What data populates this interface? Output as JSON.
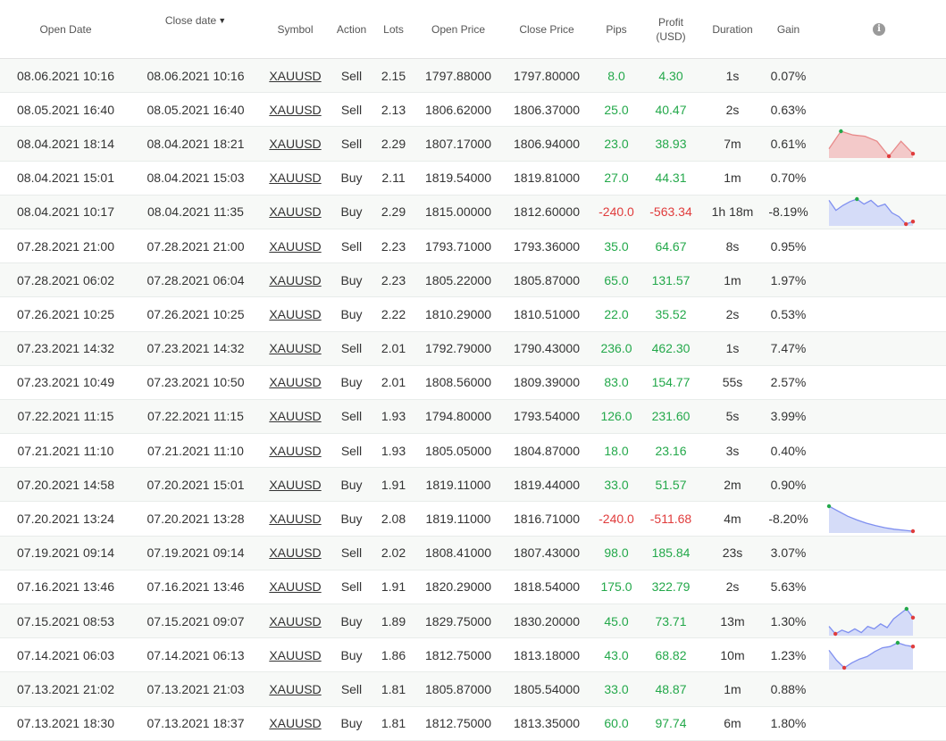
{
  "columns": {
    "open_date": "Open Date",
    "close_date": "Close date",
    "symbol": "Symbol",
    "action": "Action",
    "lots": "Lots",
    "open_price": "Open Price",
    "close_price": "Close Price",
    "pips": "Pips",
    "profit_line1": "Profit",
    "profit_line2": "(USD)",
    "duration": "Duration",
    "gain": "Gain",
    "info_icon": "info-icon",
    "sort_indicator": "▼"
  },
  "colors": {
    "positive": "#23a84a",
    "negative": "#e03c3c",
    "spark_sell_fill": "#f3c9c9",
    "spark_sell_line": "#e88a8a",
    "spark_buy_fill": "#d5dcf8",
    "spark_buy_line": "#7f8ff0",
    "marker_max": "#23a84a",
    "marker_min": "#e03c3c"
  },
  "rows": [
    {
      "open": "08.06.2021 10:16",
      "close": "08.06.2021 10:16",
      "symbol": "XAUUSD",
      "action": "Sell",
      "lots": "2.15",
      "open_price": "1797.88000",
      "close_price": "1797.80000",
      "pips": "8.0",
      "profit": "4.30",
      "duration": "1s",
      "gain": "0.07%",
      "sign": "pos"
    },
    {
      "open": "08.05.2021 16:40",
      "close": "08.05.2021 16:40",
      "symbol": "XAUUSD",
      "action": "Sell",
      "lots": "2.13",
      "open_price": "1806.62000",
      "close_price": "1806.37000",
      "pips": "25.0",
      "profit": "40.47",
      "duration": "2s",
      "gain": "0.63%",
      "sign": "pos"
    },
    {
      "open": "08.04.2021 18:14",
      "close": "08.04.2021 18:21",
      "symbol": "XAUUSD",
      "action": "Sell",
      "lots": "2.29",
      "open_price": "1807.17000",
      "close_price": "1806.94000",
      "pips": "23.0",
      "profit": "38.93",
      "duration": "7m",
      "gain": "0.61%",
      "sign": "pos",
      "spark": {
        "type": "sell",
        "values": [
          0.3,
          1.0,
          0.85,
          0.8,
          0.6,
          0.0,
          0.6,
          0.1
        ],
        "max_index": 1,
        "min_index": 5,
        "end_index": 7
      }
    },
    {
      "open": "08.04.2021 15:01",
      "close": "08.04.2021 15:03",
      "symbol": "XAUUSD",
      "action": "Buy",
      "lots": "2.11",
      "open_price": "1819.54000",
      "close_price": "1819.81000",
      "pips": "27.0",
      "profit": "44.31",
      "duration": "1m",
      "gain": "0.70%",
      "sign": "pos"
    },
    {
      "open": "08.04.2021 10:17",
      "close": "08.04.2021 11:35",
      "symbol": "XAUUSD",
      "action": "Buy",
      "lots": "2.29",
      "open_price": "1815.00000",
      "close_price": "1812.60000",
      "pips": "-240.0",
      "profit": "-563.34",
      "duration": "1h 18m",
      "gain": "-8.19%",
      "sign": "neg",
      "spark": {
        "type": "buy",
        "values": [
          0.95,
          0.55,
          0.75,
          0.9,
          1.0,
          0.8,
          0.95,
          0.7,
          0.8,
          0.45,
          0.3,
          0.0,
          0.1
        ],
        "max_index": 4,
        "min_index": 11,
        "end_index": 12
      }
    },
    {
      "open": "07.28.2021 21:00",
      "close": "07.28.2021 21:00",
      "symbol": "XAUUSD",
      "action": "Sell",
      "lots": "2.23",
      "open_price": "1793.71000",
      "close_price": "1793.36000",
      "pips": "35.0",
      "profit": "64.67",
      "duration": "8s",
      "gain": "0.95%",
      "sign": "pos"
    },
    {
      "open": "07.28.2021 06:02",
      "close": "07.28.2021 06:04",
      "symbol": "XAUUSD",
      "action": "Buy",
      "lots": "2.23",
      "open_price": "1805.22000",
      "close_price": "1805.87000",
      "pips": "65.0",
      "profit": "131.57",
      "duration": "1m",
      "gain": "1.97%",
      "sign": "pos"
    },
    {
      "open": "07.26.2021 10:25",
      "close": "07.26.2021 10:25",
      "symbol": "XAUUSD",
      "action": "Buy",
      "lots": "2.22",
      "open_price": "1810.29000",
      "close_price": "1810.51000",
      "pips": "22.0",
      "profit": "35.52",
      "duration": "2s",
      "gain": "0.53%",
      "sign": "pos"
    },
    {
      "open": "07.23.2021 14:32",
      "close": "07.23.2021 14:32",
      "symbol": "XAUUSD",
      "action": "Sell",
      "lots": "2.01",
      "open_price": "1792.79000",
      "close_price": "1790.43000",
      "pips": "236.0",
      "profit": "462.30",
      "duration": "1s",
      "gain": "7.47%",
      "sign": "pos"
    },
    {
      "open": "07.23.2021 10:49",
      "close": "07.23.2021 10:50",
      "symbol": "XAUUSD",
      "action": "Buy",
      "lots": "2.01",
      "open_price": "1808.56000",
      "close_price": "1809.39000",
      "pips": "83.0",
      "profit": "154.77",
      "duration": "55s",
      "gain": "2.57%",
      "sign": "pos"
    },
    {
      "open": "07.22.2021 11:15",
      "close": "07.22.2021 11:15",
      "symbol": "XAUUSD",
      "action": "Sell",
      "lots": "1.93",
      "open_price": "1794.80000",
      "close_price": "1793.54000",
      "pips": "126.0",
      "profit": "231.60",
      "duration": "5s",
      "gain": "3.99%",
      "sign": "pos"
    },
    {
      "open": "07.21.2021 11:10",
      "close": "07.21.2021 11:10",
      "symbol": "XAUUSD",
      "action": "Sell",
      "lots": "1.93",
      "open_price": "1805.05000",
      "close_price": "1804.87000",
      "pips": "18.0",
      "profit": "23.16",
      "duration": "3s",
      "gain": "0.40%",
      "sign": "pos"
    },
    {
      "open": "07.20.2021 14:58",
      "close": "07.20.2021 15:01",
      "symbol": "XAUUSD",
      "action": "Buy",
      "lots": "1.91",
      "open_price": "1819.11000",
      "close_price": "1819.44000",
      "pips": "33.0",
      "profit": "51.57",
      "duration": "2m",
      "gain": "0.90%",
      "sign": "pos"
    },
    {
      "open": "07.20.2021 13:24",
      "close": "07.20.2021 13:28",
      "symbol": "XAUUSD",
      "action": "Buy",
      "lots": "2.08",
      "open_price": "1819.11000",
      "close_price": "1816.71000",
      "pips": "-240.0",
      "profit": "-511.68",
      "duration": "4m",
      "gain": "-8.20%",
      "sign": "neg",
      "spark": {
        "type": "buy",
        "values": [
          1.0,
          0.8,
          0.6,
          0.45,
          0.32,
          0.22,
          0.14,
          0.08,
          0.04,
          0.0
        ],
        "max_index": 0,
        "min_index": 9,
        "end_index": 9
      }
    },
    {
      "open": "07.19.2021 09:14",
      "close": "07.19.2021 09:14",
      "symbol": "XAUUSD",
      "action": "Sell",
      "lots": "2.02",
      "open_price": "1808.41000",
      "close_price": "1807.43000",
      "pips": "98.0",
      "profit": "185.84",
      "duration": "23s",
      "gain": "3.07%",
      "sign": "pos"
    },
    {
      "open": "07.16.2021 13:46",
      "close": "07.16.2021 13:46",
      "symbol": "XAUUSD",
      "action": "Sell",
      "lots": "1.91",
      "open_price": "1820.29000",
      "close_price": "1818.54000",
      "pips": "175.0",
      "profit": "322.79",
      "duration": "2s",
      "gain": "5.63%",
      "sign": "pos"
    },
    {
      "open": "07.15.2021 08:53",
      "close": "07.15.2021 09:07",
      "symbol": "XAUUSD",
      "action": "Buy",
      "lots": "1.89",
      "open_price": "1829.75000",
      "close_price": "1830.20000",
      "pips": "45.0",
      "profit": "73.71",
      "duration": "13m",
      "gain": "1.30%",
      "sign": "pos",
      "spark": {
        "type": "buy",
        "values": [
          0.3,
          0.0,
          0.15,
          0.05,
          0.2,
          0.05,
          0.3,
          0.2,
          0.4,
          0.25,
          0.6,
          0.8,
          1.0,
          0.65
        ],
        "max_index": 12,
        "min_index": 1,
        "end_index": 13
      }
    },
    {
      "open": "07.14.2021 06:03",
      "close": "07.14.2021 06:13",
      "symbol": "XAUUSD",
      "action": "Buy",
      "lots": "1.86",
      "open_price": "1812.75000",
      "close_price": "1813.18000",
      "pips": "43.0",
      "profit": "68.82",
      "duration": "10m",
      "gain": "1.23%",
      "sign": "pos",
      "spark": {
        "type": "buy",
        "values": [
          0.7,
          0.3,
          0.0,
          0.2,
          0.35,
          0.45,
          0.65,
          0.8,
          0.85,
          1.0,
          0.9,
          0.85
        ],
        "max_index": 9,
        "min_index": 2,
        "end_index": 11
      }
    },
    {
      "open": "07.13.2021 21:02",
      "close": "07.13.2021 21:03",
      "symbol": "XAUUSD",
      "action": "Sell",
      "lots": "1.81",
      "open_price": "1805.87000",
      "close_price": "1805.54000",
      "pips": "33.0",
      "profit": "48.87",
      "duration": "1m",
      "gain": "0.88%",
      "sign": "pos"
    },
    {
      "open": "07.13.2021 18:30",
      "close": "07.13.2021 18:37",
      "symbol": "XAUUSD",
      "action": "Buy",
      "lots": "1.81",
      "open_price": "1812.75000",
      "close_price": "1813.35000",
      "pips": "60.0",
      "profit": "97.74",
      "duration": "6m",
      "gain": "1.80%",
      "sign": "pos"
    }
  ]
}
